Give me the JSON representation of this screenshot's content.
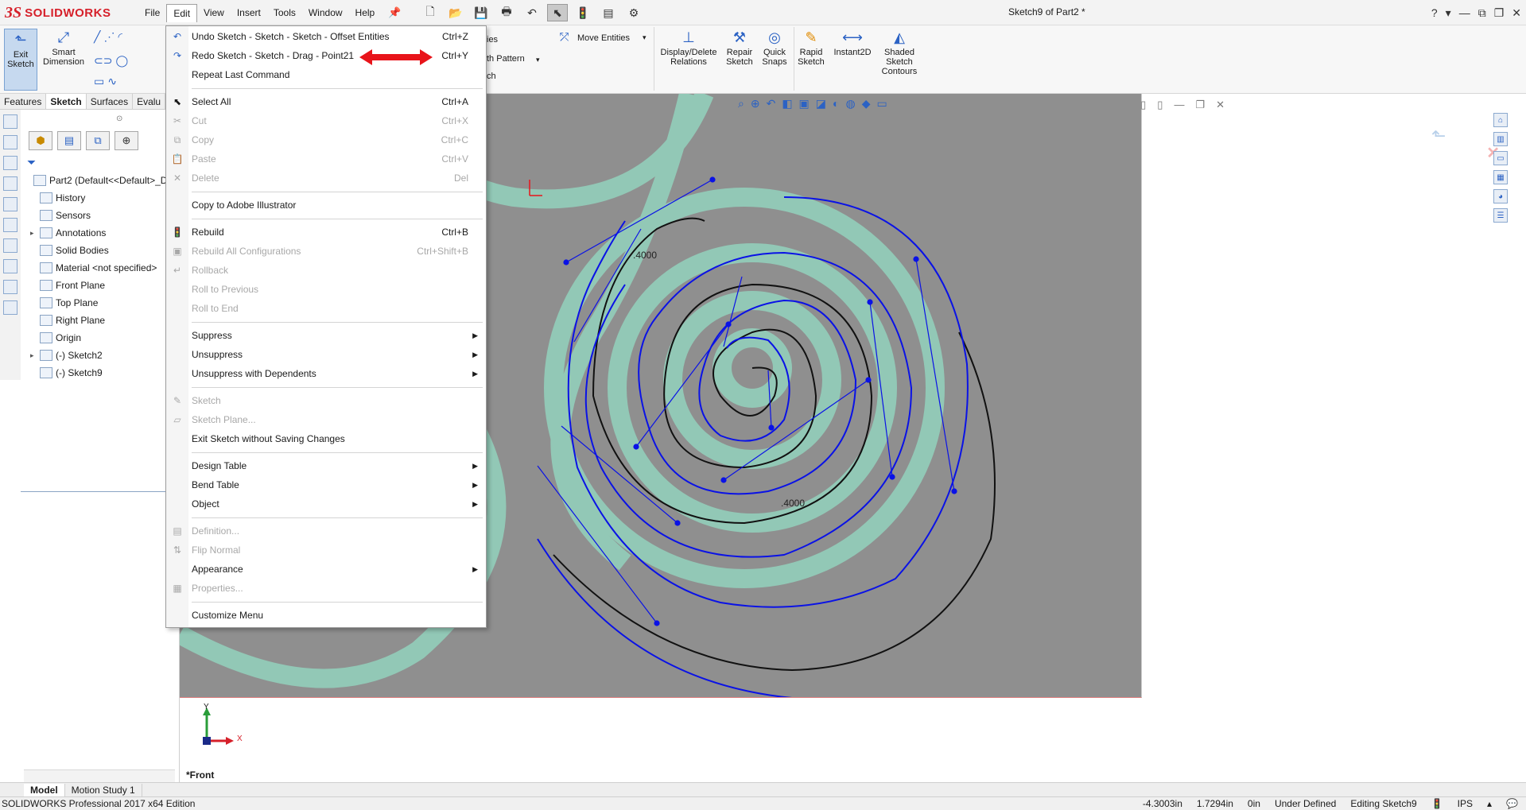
{
  "app": {
    "logo_prefix": "3S",
    "logo_name": "SOLIDWORKS",
    "doc_title": "Sketch9 of Part2 *"
  },
  "menubar": [
    "File",
    "Edit",
    "View",
    "Insert",
    "Tools",
    "Window",
    "Help"
  ],
  "command_manager": {
    "exit_sketch": "Exit Sketch",
    "smart_dimension": "Smart Dimension",
    "partial_ies": "ies",
    "move_entities": "Move Entities",
    "partial_pattern": "th Pattern",
    "partial_ch": "ch",
    "display_delete_relations": "Display/Delete Relations",
    "repair_sketch": "Repair Sketch",
    "quick_snaps": "Quick Snaps",
    "rapid_sketch": "Rapid Sketch",
    "instant2d": "Instant2D",
    "shaded_sketch_contours": "Shaded Sketch Contours"
  },
  "cmd_tabs": [
    "Features",
    "Sketch",
    "Surfaces",
    "Evalu"
  ],
  "feature_tree": [
    {
      "label": "Part2  (Default<<Default>_Di",
      "expand": ""
    },
    {
      "label": "History",
      "expand": ""
    },
    {
      "label": "Sensors",
      "expand": ""
    },
    {
      "label": "Annotations",
      "expand": "▸"
    },
    {
      "label": "Solid Bodies",
      "expand": ""
    },
    {
      "label": "Material <not specified>",
      "expand": ""
    },
    {
      "label": "Front Plane",
      "expand": ""
    },
    {
      "label": "Top Plane",
      "expand": ""
    },
    {
      "label": "Right Plane",
      "expand": ""
    },
    {
      "label": "Origin",
      "expand": ""
    },
    {
      "label": "(-) Sketch2",
      "expand": "▸"
    },
    {
      "label": "(-) Sketch9",
      "expand": ""
    }
  ],
  "edit_menu": {
    "undo": {
      "label": "Undo Sketch - Sketch - Sketch - Offset Entities",
      "shortcut": "Ctrl+Z"
    },
    "redo": {
      "label": "Redo Sketch - Sketch - Drag - Point21",
      "shortcut": "Ctrl+Y"
    },
    "repeat": {
      "label": "Repeat Last Command"
    },
    "select_all": {
      "label": "Select All",
      "shortcut": "Ctrl+A"
    },
    "cut": {
      "label": "Cut",
      "shortcut": "Ctrl+X"
    },
    "copy": {
      "label": "Copy",
      "shortcut": "Ctrl+C"
    },
    "paste": {
      "label": "Paste",
      "shortcut": "Ctrl+V"
    },
    "delete": {
      "label": "Delete",
      "shortcut": "Del"
    },
    "copy_ai": {
      "label": "Copy to Adobe Illustrator"
    },
    "rebuild": {
      "label": "Rebuild",
      "shortcut": "Ctrl+B"
    },
    "rebuild_all": {
      "label": "Rebuild All Configurations",
      "shortcut": "Ctrl+Shift+B"
    },
    "rollback": {
      "label": "Rollback"
    },
    "roll_prev": {
      "label": "Roll to Previous"
    },
    "roll_end": {
      "label": "Roll to End"
    },
    "suppress": {
      "label": "Suppress"
    },
    "unsuppress": {
      "label": "Unsuppress"
    },
    "unsuppress_dep": {
      "label": "Unsuppress with Dependents"
    },
    "sketch": {
      "label": "Sketch"
    },
    "sketch_plane": {
      "label": "Sketch Plane..."
    },
    "exit_no_save": {
      "label": "Exit Sketch without Saving Changes"
    },
    "design_table": {
      "label": "Design Table"
    },
    "bend_table": {
      "label": "Bend Table"
    },
    "object": {
      "label": "Object"
    },
    "definition": {
      "label": "Definition..."
    },
    "flip_normal": {
      "label": "Flip Normal"
    },
    "appearance": {
      "label": "Appearance"
    },
    "properties": {
      "label": "Properties..."
    },
    "customize_menu": {
      "label": "Customize Menu"
    }
  },
  "graphics": {
    "dim_1": ".4000",
    "dim_2": ".4000",
    "view_name": "*Front",
    "triad_y": "Y",
    "triad_x": "X"
  },
  "bottom_tabs": [
    "Model",
    "Motion Study 1"
  ],
  "status": {
    "edition": "SOLIDWORKS Professional 2017 x64 Edition",
    "x": "-4.3003in",
    "y": "1.7294in",
    "z": "0in",
    "definition": "Under Defined",
    "editing": "Editing Sketch9",
    "units": "IPS"
  },
  "colors": {
    "accent": "#2b62c4",
    "brand_red": "#d6202a",
    "sketch_blue": "#0a12e6",
    "teal_path": "#92c8b6",
    "photo_gray": "#8f8f8f",
    "annotation_red": "#e8141a"
  }
}
